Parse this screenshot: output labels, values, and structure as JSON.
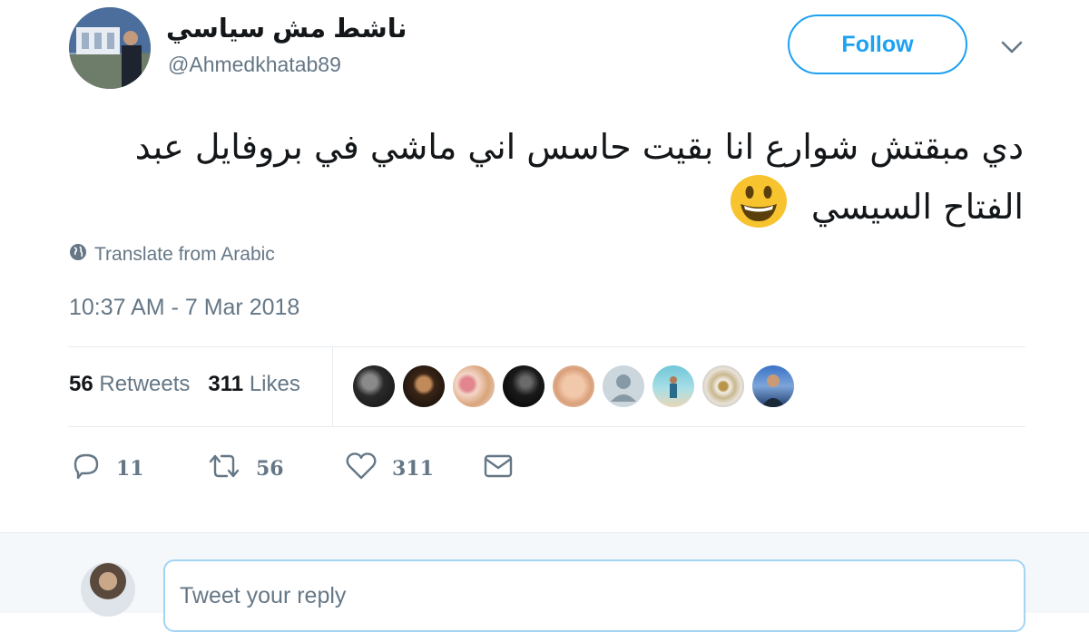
{
  "tweet": {
    "author": {
      "display_name": "ناشط مش سياسي",
      "handle": "@Ahmedkhatab89"
    },
    "follow_label": "Follow",
    "text_line1": "دي مبقتش شوارع انا بقيت حاسس اني ماشي في بروفايل عبد",
    "text_line2": "الفتاح السيسي",
    "translate_label": "Translate from Arabic",
    "timestamp": "10:37 AM - 7 Mar 2018",
    "stats": {
      "retweets_count": "56",
      "retweets_label": "Retweets",
      "likes_count": "311",
      "likes_label": "Likes"
    },
    "actions": {
      "reply_count": "11",
      "retweet_count": "56",
      "like_count": "311"
    }
  },
  "reply_box": {
    "placeholder": "Tweet your reply"
  },
  "colors": {
    "accent": "#1da1f2",
    "secondary_text": "#657786",
    "divider": "#e6ecf0"
  },
  "icons": [
    "chevron-down-icon",
    "globe-icon",
    "smiley-emoji",
    "reply-icon",
    "retweet-icon",
    "heart-icon",
    "envelope-icon"
  ]
}
